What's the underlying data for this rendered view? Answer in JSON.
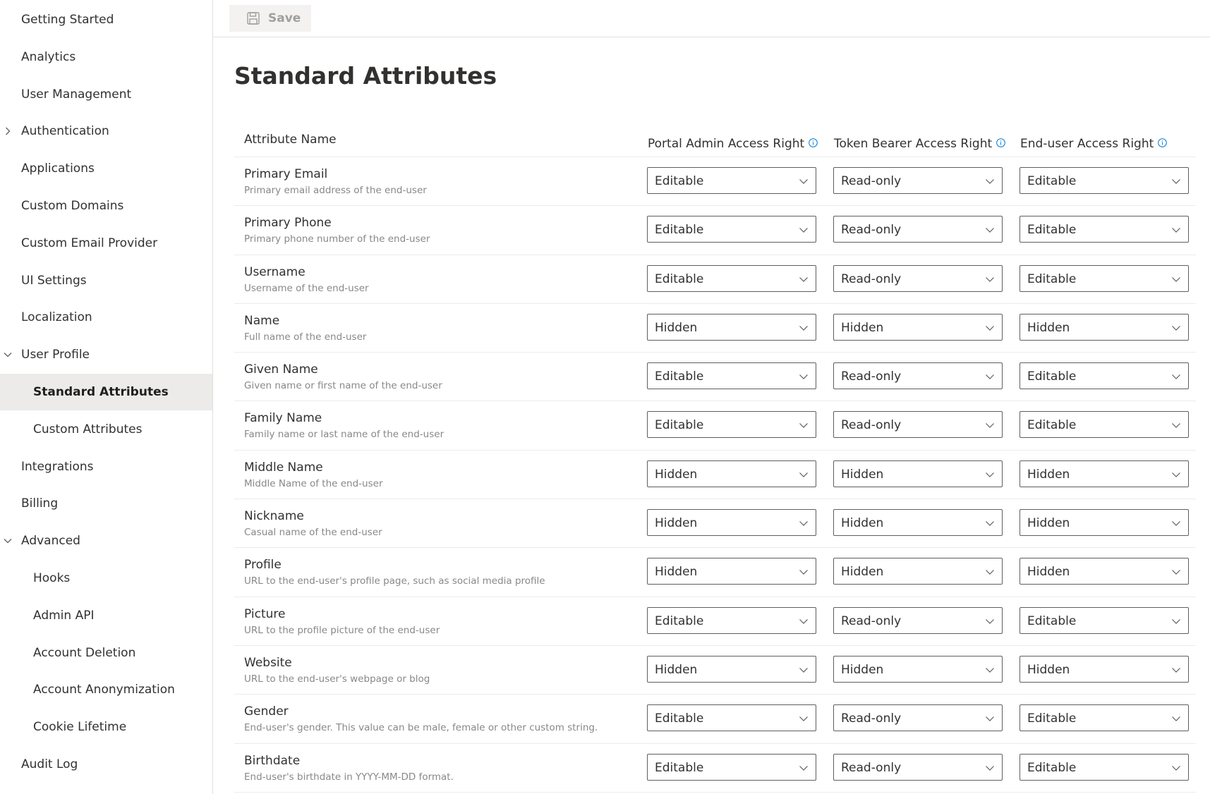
{
  "sidebar": {
    "items": [
      {
        "label": "Getting Started",
        "level": 1
      },
      {
        "label": "Analytics",
        "level": 1
      },
      {
        "label": "User Management",
        "level": 1
      },
      {
        "label": "Authentication",
        "level": 1,
        "chevron": "right"
      },
      {
        "label": "Applications",
        "level": 1
      },
      {
        "label": "Custom Domains",
        "level": 1
      },
      {
        "label": "Custom Email Provider",
        "level": 1
      },
      {
        "label": "UI Settings",
        "level": 1
      },
      {
        "label": "Localization",
        "level": 1
      },
      {
        "label": "User Profile",
        "level": 1,
        "chevron": "down"
      },
      {
        "label": "Standard Attributes",
        "level": 2,
        "selected": true
      },
      {
        "label": "Custom Attributes",
        "level": 2
      },
      {
        "label": "Integrations",
        "level": 1
      },
      {
        "label": "Billing",
        "level": 1
      },
      {
        "label": "Advanced",
        "level": 1,
        "chevron": "down"
      },
      {
        "label": "Hooks",
        "level": 2
      },
      {
        "label": "Admin API",
        "level": 2
      },
      {
        "label": "Account Deletion",
        "level": 2
      },
      {
        "label": "Account Anonymization",
        "level": 2
      },
      {
        "label": "Cookie Lifetime",
        "level": 2
      },
      {
        "label": "Audit Log",
        "level": 1
      }
    ]
  },
  "toolbar": {
    "save_label": "Save",
    "save_icon": "floppy-disk-icon"
  },
  "page": {
    "title": "Standard Attributes"
  },
  "table": {
    "headers": {
      "attribute": "Attribute Name",
      "portal_admin": "Portal Admin Access Right",
      "token_bearer": "Token Bearer Access Right",
      "end_user": "End-user Access Right"
    },
    "rows": [
      {
        "name": "Primary Email",
        "desc": "Primary email address of the end-user",
        "portal_admin": "Editable",
        "token_bearer": "Read-only",
        "end_user": "Editable"
      },
      {
        "name": "Primary Phone",
        "desc": "Primary phone number of the end-user",
        "portal_admin": "Editable",
        "token_bearer": "Read-only",
        "end_user": "Editable"
      },
      {
        "name": "Username",
        "desc": "Username of the end-user",
        "portal_admin": "Editable",
        "token_bearer": "Read-only",
        "end_user": "Editable"
      },
      {
        "name": "Name",
        "desc": "Full name of the end-user",
        "portal_admin": "Hidden",
        "token_bearer": "Hidden",
        "end_user": "Hidden"
      },
      {
        "name": "Given Name",
        "desc": "Given name or first name of the end-user",
        "portal_admin": "Editable",
        "token_bearer": "Read-only",
        "end_user": "Editable"
      },
      {
        "name": "Family Name",
        "desc": "Family name or last name of the end-user",
        "portal_admin": "Editable",
        "token_bearer": "Read-only",
        "end_user": "Editable"
      },
      {
        "name": "Middle Name",
        "desc": "Middle Name of the end-user",
        "portal_admin": "Hidden",
        "token_bearer": "Hidden",
        "end_user": "Hidden"
      },
      {
        "name": "Nickname",
        "desc": "Casual name of the end-user",
        "portal_admin": "Hidden",
        "token_bearer": "Hidden",
        "end_user": "Hidden"
      },
      {
        "name": "Profile",
        "desc": "URL to the end-user's profile page, such as social media profile",
        "portal_admin": "Hidden",
        "token_bearer": "Hidden",
        "end_user": "Hidden"
      },
      {
        "name": "Picture",
        "desc": "URL to the profile picture of the end-user",
        "portal_admin": "Editable",
        "token_bearer": "Read-only",
        "end_user": "Editable"
      },
      {
        "name": "Website",
        "desc": "URL to the end-user's webpage or blog",
        "portal_admin": "Hidden",
        "token_bearer": "Hidden",
        "end_user": "Hidden"
      },
      {
        "name": "Gender",
        "desc": "End-user's gender. This value can be male, female or other custom string.",
        "portal_admin": "Editable",
        "token_bearer": "Read-only",
        "end_user": "Editable"
      },
      {
        "name": "Birthdate",
        "desc": "End-user's birthdate in YYYY-MM-DD format.",
        "portal_admin": "Editable",
        "token_bearer": "Read-only",
        "end_user": "Editable"
      }
    ]
  },
  "colors": {
    "selected_bg": "#edebe9",
    "info_icon": "#0078d4",
    "border": "#605e5c",
    "muted_text": "#8a8886"
  }
}
